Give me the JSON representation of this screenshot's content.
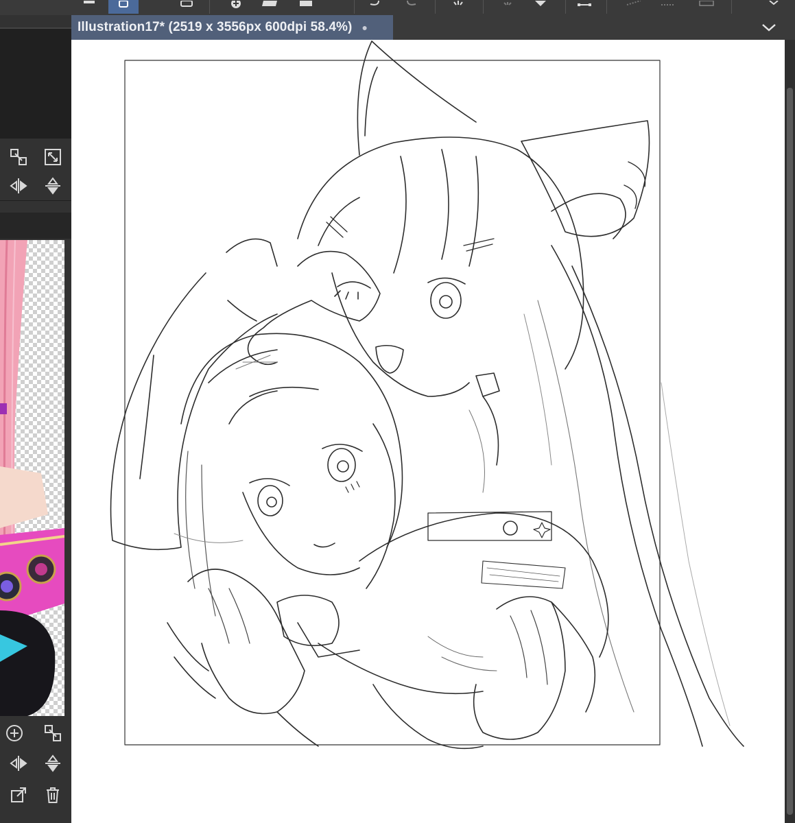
{
  "document_tab": {
    "title": "Illustration17* (2519 x 3556px 600dpi 58.4%)",
    "close_glyph": "●",
    "menu_glyph": "⌄"
  },
  "toolbar": {
    "active_tool": "layer-icon",
    "icons": [
      "menu-icon",
      "layer-icon",
      "stack-icon",
      "add-layer-icon",
      "folder-icon",
      "undo-icon",
      "redo-icon",
      "light-icon",
      "brush-icon",
      "fill-icon",
      "transform-icon",
      "ruler-icon",
      "keyboard-icon"
    ]
  },
  "left_panel": {
    "icons_top": [
      "resize-icon",
      "expand-icon",
      "flip-horizontal-icon",
      "flip-vertical-icon"
    ],
    "icons_bottom": [
      "add-circle-icon",
      "resize-icon",
      "flip-horizontal-icon",
      "flip-vertical-icon",
      "export-icon",
      "trash-icon"
    ]
  },
  "colors": {
    "tab_active": "#51607a",
    "toolbar_active": "#4b6a9a",
    "panel_bg": "#323232",
    "canvas_bg": "#ffffff"
  }
}
